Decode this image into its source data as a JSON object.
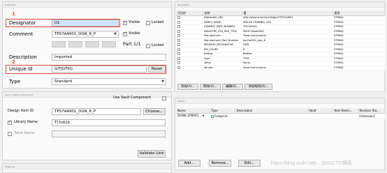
{
  "properties": {
    "section_title": "Properties",
    "designator_label": "Designator",
    "designator_value": "U1",
    "comment_label": "Comment",
    "comment_value": "TPS7A4901_DGN_8_P",
    "visible_label": "Visible",
    "locked_label": "Locked",
    "part_label": "Part 1/1",
    "description_label": "Description",
    "description_value": "Imported",
    "unique_id_label": "Unique Id",
    "unique_id_value": "GITJGTKG",
    "reset_label": "Reset",
    "type_label": "Type",
    "type_value": "Standard",
    "annotation_1": "1",
    "annotation_2": "2"
  },
  "library_link": {
    "section_title": "Link to Library Component",
    "use_vault_label": "Use Vault Component",
    "design_item_label": "Design Item ID",
    "design_item_value": "TPS7A4901_DGN_8_P",
    "choose_label": "Choose...",
    "library_name_label": "Library Name",
    "library_name_value": "TI.IntLib",
    "table_name_label": "Table Name",
    "validate_label": "Validate Link"
  },
  "graphical": {
    "section_title": "Graphical"
  },
  "parameters": {
    "section_title": "Parameters",
    "columns": [
      "可见的",
      "名称",
      "值",
      "类型"
    ],
    "rows": [
      {
        "name": "Datasheet_URL",
        "value": "http://www.ti.com/cn/lit/gpn/TPS7A4901",
        "type": "STRING"
      },
      {
        "name": "FAMILY_NAME",
        "value": "SINGLE CHANNEL LDO",
        "type": "STRING"
      },
      {
        "name": "GENERIC_PART_NUMBER",
        "value": "TPS7A4901",
        "type": "STRING"
      },
      {
        "name": "INDUSTRY_STD_PKG_TYPE",
        "value": "MSOP-PowerPAD",
        "type": "STRING"
      },
      {
        "name": "Manufacturer",
        "value": "Texas Instruments",
        "type": "STRING"
      },
      {
        "name": "Manufacturer_Part_Number",
        "value": "tps7a4901_dgn_8",
        "type": "STRING"
      },
      {
        "name": "PACKAGE_DESIGNATOR",
        "value": "DGN",
        "type": "STRING"
      },
      {
        "name": "PIN_COUNT",
        "value": "8",
        "type": "STRING"
      },
      {
        "name": "RefDes",
        "value": "RefDes",
        "type": "STRING"
      },
      {
        "name": "Type",
        "value": "TYPE",
        "type": "STRING"
      },
      {
        "name": "Value",
        "value": "Value",
        "type": "STRING"
      },
      {
        "name": "Vendor",
        "value": "Texas Instruments",
        "type": "STRING"
      }
    ],
    "add_label": "添加(A)...",
    "remove_label": "移除(V)...",
    "edit_label": "编辑(E)...",
    "add_rule_label": "添加规则(R)..."
  },
  "models": {
    "section_title": "Models",
    "columns": [
      "Name",
      "Type",
      "Description",
      "Vault",
      "Item Revisi...",
      "Revision Sta..."
    ],
    "rows": [
      {
        "name": "DGN8_1P89X1...",
        "type": "Footprint",
        "description": "",
        "vault": "",
        "item_revision": "",
        "revision_state": "[Unknown]"
      }
    ],
    "add_label": "Add...",
    "remove_label": "Remove...",
    "edit_label": "Edit..."
  },
  "watermark": "https://blog.csdn.net/... @51CTO博客"
}
